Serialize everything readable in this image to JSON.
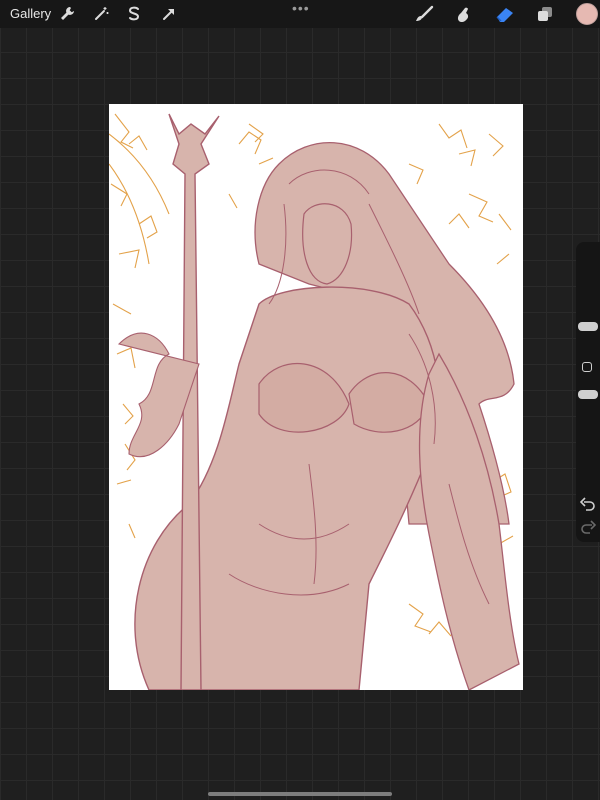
{
  "toolbar": {
    "gallery_label": "Gallery",
    "more_dots": "•••",
    "active_color": "#e6b9b2",
    "icons": [
      "wrench-icon",
      "magic-wand-icon",
      "selection-icon",
      "transform-arrow-icon",
      "brush-icon",
      "smudge-icon",
      "eraser-icon",
      "layers-icon"
    ]
  },
  "artwork": {
    "line_color": "#a8606e",
    "fill_color": "#d7b4ac",
    "sketch_color": "#e3a24a"
  }
}
